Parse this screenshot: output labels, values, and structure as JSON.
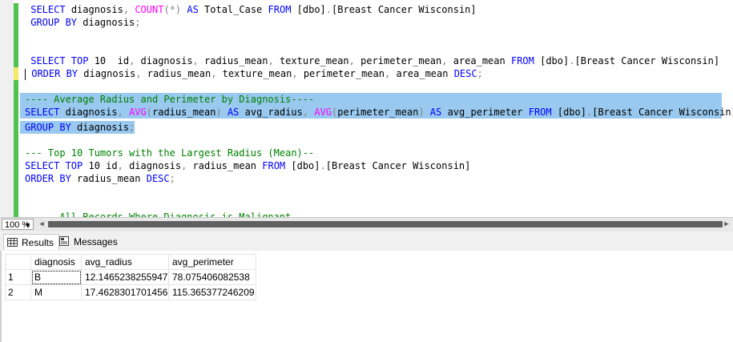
{
  "editor": {
    "lines": [
      {
        "segments": [
          {
            "t": " "
          },
          {
            "t": "SELECT",
            "c": "kw"
          },
          {
            "t": " diagnosis"
          },
          {
            "t": ",",
            "c": "gr"
          },
          {
            "t": " "
          },
          {
            "t": "COUNT",
            "c": "fn"
          },
          {
            "t": "(*)",
            "c": "gr"
          },
          {
            "t": " "
          },
          {
            "t": "AS",
            "c": "kw"
          },
          {
            "t": " Total_Case "
          },
          {
            "t": "FROM",
            "c": "kw"
          },
          {
            "t": " [dbo]"
          },
          {
            "t": ".",
            "c": "gr"
          },
          {
            "t": "[Breast Cancer Wisconsin]"
          }
        ],
        "bar": "#4fc34f"
      },
      {
        "segments": [
          {
            "t": " "
          },
          {
            "t": "GROUP BY",
            "c": "kw"
          },
          {
            "t": " diagnosis"
          },
          {
            "t": ";",
            "c": "gr"
          }
        ],
        "bar": "#4fc34f"
      },
      {
        "segments": [],
        "bar": "#4fc34f"
      },
      {
        "segments": [],
        "bar": "#4fc34f"
      },
      {
        "segments": [
          {
            "t": " "
          },
          {
            "t": "SELECT TOP",
            "c": "kw"
          },
          {
            "t": " 10  id"
          },
          {
            "t": ",",
            "c": "gr"
          },
          {
            "t": " diagnosis"
          },
          {
            "t": ",",
            "c": "gr"
          },
          {
            "t": " radius_mean"
          },
          {
            "t": ",",
            "c": "gr"
          },
          {
            "t": " texture_mean"
          },
          {
            "t": ",",
            "c": "gr"
          },
          {
            "t": " perimeter_mean"
          },
          {
            "t": ",",
            "c": "gr"
          },
          {
            "t": " area_mean "
          },
          {
            "t": "FROM",
            "c": "kw"
          },
          {
            "t": " [dbo]"
          },
          {
            "t": ".",
            "c": "gr"
          },
          {
            "t": "[Breast Cancer Wisconsin]"
          }
        ],
        "bar": "#4fc34f"
      },
      {
        "segments": [
          {
            "t": " "
          },
          {
            "t": "ORDER BY",
            "c": "kw"
          },
          {
            "t": " diagnosis"
          },
          {
            "t": ",",
            "c": "gr"
          },
          {
            "t": " radius_mean"
          },
          {
            "t": ",",
            "c": "gr"
          },
          {
            "t": " texture_mean"
          },
          {
            "t": ",",
            "c": "gr"
          },
          {
            "t": " perimeter_mean"
          },
          {
            "t": ",",
            "c": "gr"
          },
          {
            "t": " area_mean "
          },
          {
            "t": "DESC",
            "c": "kw"
          },
          {
            "t": ";",
            "c": "gr"
          }
        ],
        "bar": "#f5e96b"
      },
      {
        "segments": [],
        "bar": "#4fc34f"
      },
      {
        "segments": [
          {
            "t": "---- Average Radius and Perimeter by Diagnosis----",
            "c": "cm"
          }
        ],
        "bar": "#4fc34f",
        "hl": true
      },
      {
        "segments": [
          {
            "t": "SELECT",
            "c": "kw"
          },
          {
            "t": " diagnosis"
          },
          {
            "t": ",",
            "c": "gr"
          },
          {
            "t": " "
          },
          {
            "t": "AVG",
            "c": "fn"
          },
          {
            "t": "(",
            "c": "gr"
          },
          {
            "t": "radius_mean"
          },
          {
            "t": ")",
            "c": "gr"
          },
          {
            "t": " "
          },
          {
            "t": "AS",
            "c": "kw"
          },
          {
            "t": " avg_radius"
          },
          {
            "t": ",",
            "c": "gr"
          },
          {
            "t": " "
          },
          {
            "t": "AVG",
            "c": "fn"
          },
          {
            "t": "(",
            "c": "gr"
          },
          {
            "t": "perimeter_mean"
          },
          {
            "t": ")",
            "c": "gr"
          },
          {
            "t": " "
          },
          {
            "t": "AS",
            "c": "kw"
          },
          {
            "t": " avg_perimeter "
          },
          {
            "t": "FROM",
            "c": "kw"
          },
          {
            "t": " [dbo]"
          },
          {
            "t": ".",
            "c": "gr"
          },
          {
            "t": "[Breast Cancer Wisconsin]"
          }
        ],
        "bar": "#4fc34f",
        "hl": true
      },
      {
        "segments": [
          {
            "t": "GROUP BY",
            "c": "kw"
          },
          {
            "t": " diagnosis"
          },
          {
            "t": ";",
            "c": "gr"
          }
        ],
        "bar": "#4fc34f",
        "hl": true,
        "hlWidth": "short"
      },
      {
        "segments": [],
        "bar": "#4fc34f"
      },
      {
        "segments": [
          {
            "t": "--- Top 10 Tumors with the Largest Radius (Mean)--",
            "c": "cm"
          }
        ],
        "bar": "#4fc34f"
      },
      {
        "segments": [
          {
            "t": "SELECT TOP",
            "c": "kw"
          },
          {
            "t": " 10 id"
          },
          {
            "t": ",",
            "c": "gr"
          },
          {
            "t": " diagnosis"
          },
          {
            "t": ",",
            "c": "gr"
          },
          {
            "t": " radius_mean "
          },
          {
            "t": "FROM",
            "c": "kw"
          },
          {
            "t": " [dbo]"
          },
          {
            "t": ".",
            "c": "gr"
          },
          {
            "t": "[Breast Cancer Wisconsin]"
          }
        ],
        "bar": "#4fc34f"
      },
      {
        "segments": [
          {
            "t": "ORDER BY",
            "c": "kw"
          },
          {
            "t": " radius_mean "
          },
          {
            "t": "DESC",
            "c": "kw"
          },
          {
            "t": ";",
            "c": "gr"
          }
        ],
        "bar": "#4fc34f"
      },
      {
        "segments": [],
        "bar": "#4fc34f"
      },
      {
        "segments": [],
        "bar": "#4fc34f"
      },
      {
        "segments": [
          {
            "t": "----  All Records Where Diagnosis is Malignant--",
            "c": "cm"
          }
        ],
        "bar": "#4fc34f"
      }
    ]
  },
  "zoom": {
    "value": "100 %"
  },
  "tabs": [
    {
      "label": "Results",
      "icon": "grid-icon",
      "active": true
    },
    {
      "label": "Messages",
      "icon": "messages-icon",
      "active": false
    }
  ],
  "results": {
    "columns": [
      "diagnosis",
      "avg_radius",
      "avg_perimeter"
    ],
    "rows": [
      {
        "num": "1",
        "cells": [
          "B",
          "12.1465238255947",
          "78.075406082538"
        ]
      },
      {
        "num": "2",
        "cells": [
          "M",
          "17.4628301701456",
          "115.365377246209"
        ]
      }
    ]
  },
  "colors": {
    "keyword": "#0000ff",
    "function": "#ff00ff",
    "comment": "#008000",
    "operator": "#808080",
    "selection": "#99c9ef"
  }
}
